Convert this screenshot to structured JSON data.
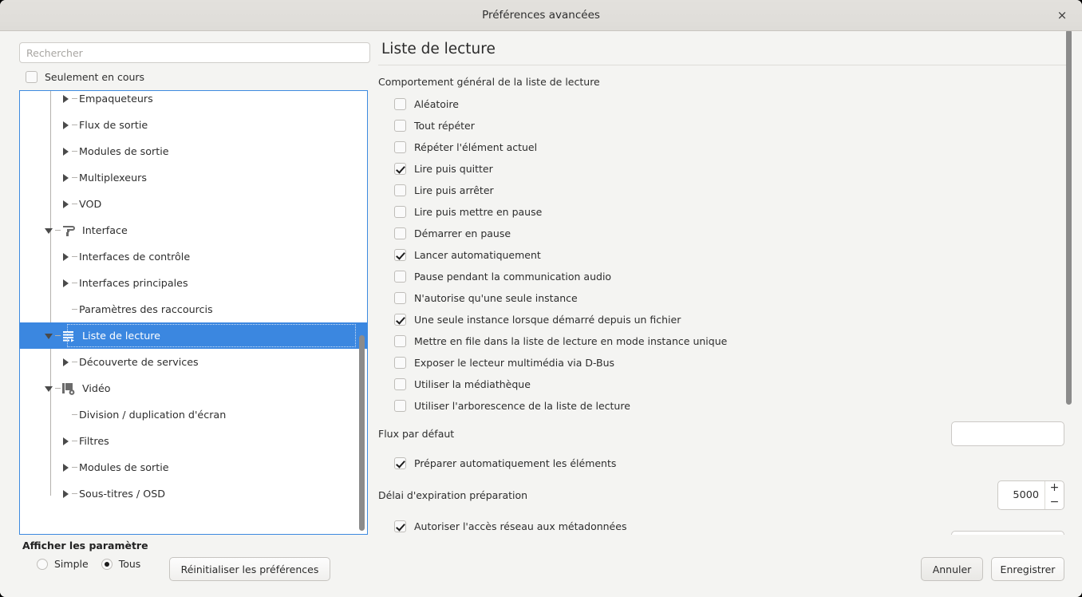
{
  "titlebar": {
    "title": "Préférences avancées",
    "close_icon": "close-icon",
    "close_glyph": "×"
  },
  "sidebar": {
    "search": {
      "placeholder": "Rechercher",
      "value": ""
    },
    "only_current": {
      "label": "Seulement en cours",
      "checked": false
    },
    "tree": [
      {
        "label": "Empaqueteurs",
        "depth": 2,
        "twisty": "closed",
        "icon": null,
        "selected": false
      },
      {
        "label": "Flux de sortie",
        "depth": 2,
        "twisty": "closed",
        "icon": null,
        "selected": false
      },
      {
        "label": "Modules de sortie",
        "depth": 2,
        "twisty": "closed",
        "icon": null,
        "selected": false
      },
      {
        "label": "Multiplexeurs",
        "depth": 2,
        "twisty": "closed",
        "icon": null,
        "selected": false
      },
      {
        "label": "VOD",
        "depth": 2,
        "twisty": "closed",
        "icon": null,
        "selected": false
      },
      {
        "label": "Interface",
        "depth": 1,
        "twisty": "open",
        "icon": "brush-icon",
        "selected": false
      },
      {
        "label": "Interfaces de contrôle",
        "depth": 2,
        "twisty": "closed",
        "icon": null,
        "selected": false
      },
      {
        "label": "Interfaces principales",
        "depth": 2,
        "twisty": "closed",
        "icon": null,
        "selected": false
      },
      {
        "label": "Paramètres des raccourcis",
        "depth": 2,
        "twisty": "leaf",
        "icon": null,
        "selected": false
      },
      {
        "label": "Liste de lecture",
        "depth": 1,
        "twisty": "open",
        "icon": "playlist-icon",
        "selected": true
      },
      {
        "label": "Découverte de services",
        "depth": 2,
        "twisty": "closed",
        "icon": null,
        "selected": false
      },
      {
        "label": "Vidéo",
        "depth": 1,
        "twisty": "open",
        "icon": "video-icon",
        "selected": false
      },
      {
        "label": "Division / duplication d'écran",
        "depth": 2,
        "twisty": "leaf",
        "icon": null,
        "selected": false
      },
      {
        "label": "Filtres",
        "depth": 2,
        "twisty": "closed",
        "icon": null,
        "selected": false
      },
      {
        "label": "Modules de sortie",
        "depth": 2,
        "twisty": "closed",
        "icon": null,
        "selected": false
      },
      {
        "label": "Sous-titres / OSD",
        "depth": 2,
        "twisty": "closed",
        "icon": null,
        "selected": false
      }
    ],
    "selection_color": "#3b87e0",
    "frame_border_color": "#3d8ae0"
  },
  "main": {
    "title": "Liste de lecture",
    "section_label": "Comportement général de la liste de lecture",
    "options": [
      {
        "label": "Aléatoire",
        "checked": false
      },
      {
        "label": "Tout répéter",
        "checked": false
      },
      {
        "label": "Répéter l'élément actuel",
        "checked": false
      },
      {
        "label": "Lire puis quitter",
        "checked": true
      },
      {
        "label": "Lire puis arrêter",
        "checked": false
      },
      {
        "label": "Lire puis mettre en pause",
        "checked": false
      },
      {
        "label": "Démarrer en pause",
        "checked": false
      },
      {
        "label": "Lancer automatiquement",
        "checked": true
      },
      {
        "label": "Pause pendant la communication audio",
        "checked": false
      },
      {
        "label": "N'autorise qu'une seule instance",
        "checked": false
      },
      {
        "label": "Une seule instance lorsque démarré depuis un fichier",
        "checked": true
      },
      {
        "label": "Mettre en file dans la liste de lecture en mode instance unique",
        "checked": false
      },
      {
        "label": "Exposer le lecteur multimédia via D-Bus",
        "checked": false
      },
      {
        "label": "Utiliser la médiathèque",
        "checked": false
      },
      {
        "label": "Utiliser l'arborescence de la liste de lecture",
        "checked": false
      }
    ],
    "default_stream": {
      "label": "Flux par défaut",
      "value": "",
      "placeholder": ""
    },
    "preparse": {
      "label": "Préparer automatiquement les éléments",
      "checked": true
    },
    "preparse_timeout": {
      "label": "Délai d'expiration préparation",
      "value": "5000",
      "increment_glyph": "+",
      "decrement_glyph": "−"
    },
    "network_metadata": {
      "label": "Autoriser l'accès réseau aux métadonnées",
      "checked": true
    }
  },
  "footer": {
    "heading": "Afficher les paramètre",
    "radios": [
      {
        "label": "Simple",
        "checked": false
      },
      {
        "label": "Tous",
        "checked": true
      }
    ],
    "reset_label": "Réinitialiser les préférences",
    "cancel_label": "Annuler",
    "save_label": "Enregistrer"
  }
}
